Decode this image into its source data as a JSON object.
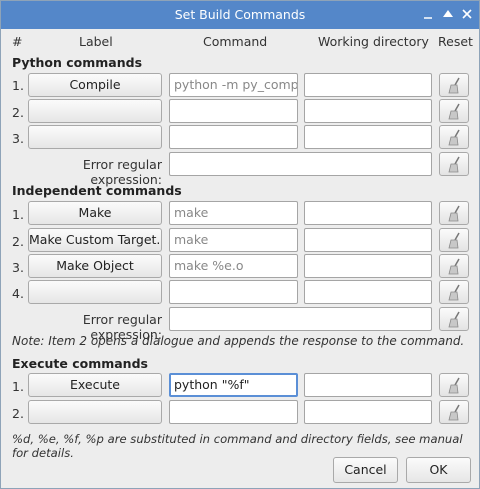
{
  "window": {
    "title": "Set Build Commands",
    "controls": [
      "minimize-icon",
      "maximize-icon",
      "close-icon"
    ]
  },
  "columns": {
    "num": "#",
    "label": "Label",
    "command": "Command",
    "workdir": "Working directory",
    "reset": "Reset"
  },
  "python": {
    "title": "Python commands",
    "rows": [
      {
        "num": "1.",
        "label": "Compile",
        "command": "python -m py_compile \"%f\"",
        "workdir": ""
      },
      {
        "num": "2.",
        "label": "",
        "command": "",
        "workdir": ""
      },
      {
        "num": "3.",
        "label": "",
        "command": "",
        "workdir": ""
      }
    ],
    "error_label": "Error regular expression:",
    "error_value": ""
  },
  "independent": {
    "title": "Independent commands",
    "rows": [
      {
        "num": "1.",
        "label": "Make",
        "command": "make",
        "workdir": ""
      },
      {
        "num": "2.",
        "label": "Make Custom Target...",
        "command": "make",
        "workdir": ""
      },
      {
        "num": "3.",
        "label": "Make Object",
        "command": "make %e.o",
        "workdir": ""
      },
      {
        "num": "4.",
        "label": "",
        "command": "",
        "workdir": ""
      }
    ],
    "error_label": "Error regular expression:",
    "error_value": ""
  },
  "note": "Note: Item 2 opens a dialogue and appends the response to the command.",
  "execute": {
    "title": "Execute commands",
    "rows": [
      {
        "num": "1.",
        "label": "Execute",
        "command": "python \"%f\"",
        "workdir": ""
      },
      {
        "num": "2.",
        "label": "",
        "command": "",
        "workdir": ""
      }
    ]
  },
  "footnote": "%d, %e, %f, %p are substituted in command and directory fields, see manual for details.",
  "buttons": {
    "cancel": "Cancel",
    "ok": "OK"
  },
  "colors": {
    "titlebar": "#5487c9",
    "focus_border": "#5b8fd6",
    "dialog_bg": "#ededed"
  }
}
